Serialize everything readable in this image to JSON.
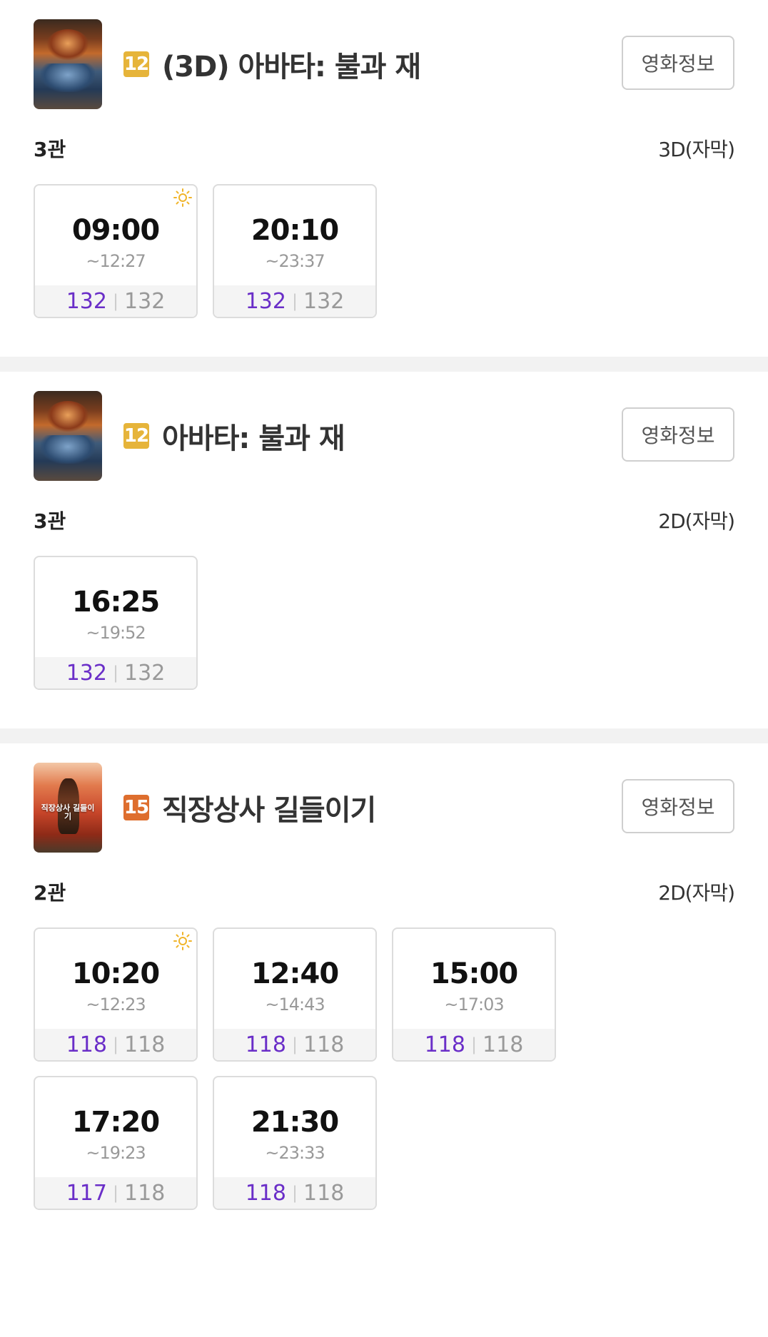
{
  "colors": {
    "rating_12": "#e6b43a",
    "rating_15": "#de6e2e",
    "available_seats": "#6a2ec8",
    "divider": "#f2f2f2",
    "morning_icon": "#f0b429"
  },
  "movies": [
    {
      "title": "(3D) 아바타: 불과 재",
      "rating": "12",
      "info_button": "영화정보",
      "hall": "3관",
      "format": "3D(자막)",
      "showtimes": [
        {
          "start": "09:00",
          "end": "~12:27",
          "available": "132",
          "total": "132",
          "morning": true
        },
        {
          "start": "20:10",
          "end": "~23:37",
          "available": "132",
          "total": "132",
          "morning": false
        }
      ]
    },
    {
      "title": "아바타: 불과 재",
      "rating": "12",
      "info_button": "영화정보",
      "hall": "3관",
      "format": "2D(자막)",
      "showtimes": [
        {
          "start": "16:25",
          "end": "~19:52",
          "available": "132",
          "total": "132",
          "morning": false
        }
      ]
    },
    {
      "title": "직장상사 길들이기",
      "rating": "15",
      "poster_text": "직장상사 길들이기",
      "info_button": "영화정보",
      "hall": "2관",
      "format": "2D(자막)",
      "showtimes": [
        {
          "start": "10:20",
          "end": "~12:23",
          "available": "118",
          "total": "118",
          "morning": true
        },
        {
          "start": "12:40",
          "end": "~14:43",
          "available": "118",
          "total": "118",
          "morning": false
        },
        {
          "start": "15:00",
          "end": "~17:03",
          "available": "118",
          "total": "118",
          "morning": false
        },
        {
          "start": "17:20",
          "end": "~19:23",
          "available": "117",
          "total": "118",
          "morning": false
        },
        {
          "start": "21:30",
          "end": "~23:33",
          "available": "118",
          "total": "118",
          "morning": false
        }
      ]
    }
  ]
}
